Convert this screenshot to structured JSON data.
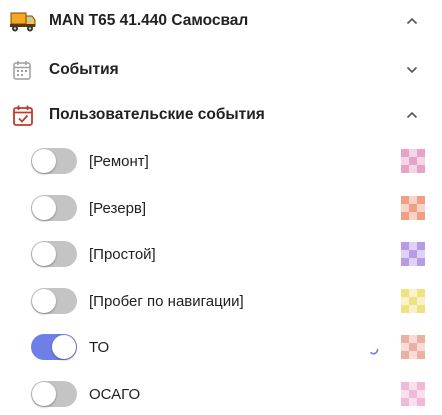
{
  "vehicle": {
    "title": "MAN T65 41.440 Самосвал",
    "icon": "dump-truck-icon"
  },
  "events_section": {
    "label": "События",
    "icon": "calendar-icon",
    "expanded": false
  },
  "custom_events_section": {
    "label": "Пользовательские события",
    "icon": "calendar-check-icon",
    "expanded": true
  },
  "events": [
    {
      "label": "[Ремонт]",
      "enabled": false,
      "color": "#e4a3c7"
    },
    {
      "label": "[Резерв]",
      "enabled": false,
      "color": "#ef9f84"
    },
    {
      "label": "[Простой]",
      "enabled": false,
      "color": "#b79be6"
    },
    {
      "label": "[Пробег по навигации]",
      "enabled": false,
      "color": "#ede383"
    },
    {
      "label": "ТО",
      "enabled": true,
      "color": "#eab0a3"
    },
    {
      "label": "ОСАГО",
      "enabled": false,
      "color": "#f0b9d8"
    }
  ],
  "colors": {
    "toggle_on": "#6f7fe8",
    "toggle_off": "#c4c4c4",
    "custom_events_icon": "#c0392b",
    "truck_body": "#f5a623"
  }
}
